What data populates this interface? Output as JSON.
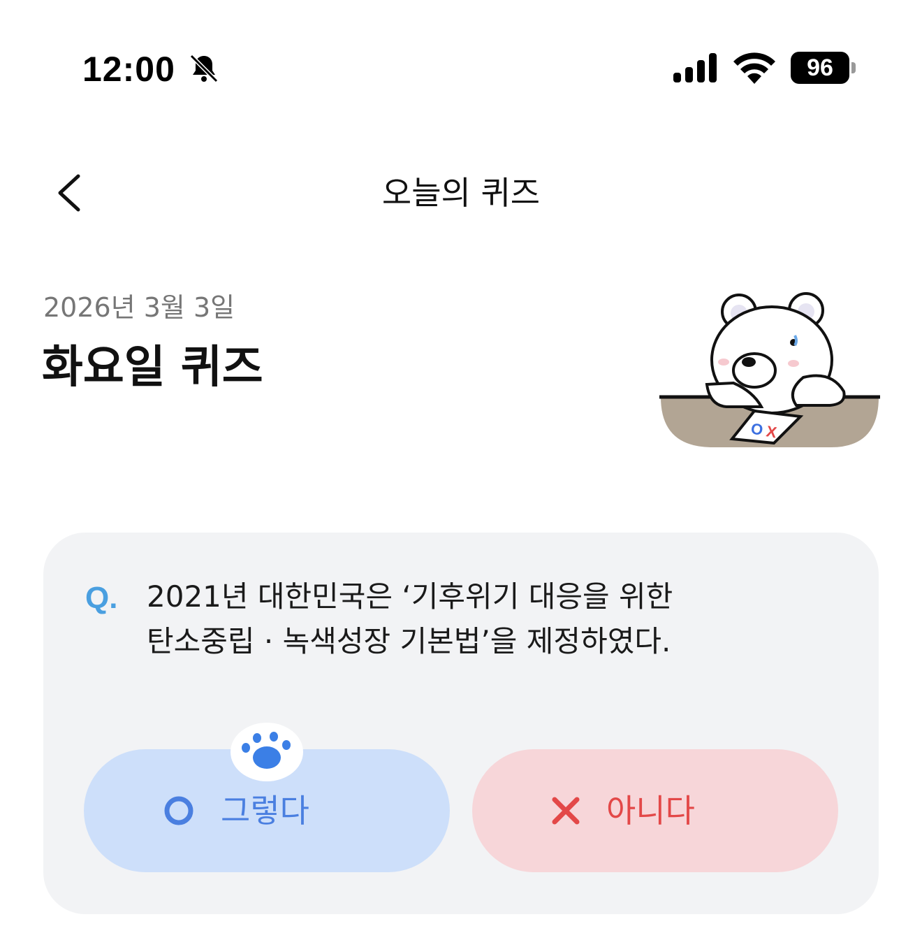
{
  "status_bar": {
    "time": "12:00",
    "bell_icon": "bell-slash-icon",
    "signal_icon": "cellular-signal-icon",
    "wifi_icon": "wifi-icon",
    "battery_level": "96"
  },
  "header": {
    "back_icon": "chevron-left-icon",
    "title": "오늘의 퀴즈"
  },
  "quiz": {
    "date": "2026년 3월 3일",
    "title": "화요일 퀴즈",
    "illustration": "bear-with-ox-paper",
    "question_prefix": "Q.",
    "question_lines": [
      "2021년 대한민국은 ‘기후위기 대응을 위한",
      "탄소중립 · 녹색성장 기본법’을 제정하였다."
    ],
    "answers": {
      "yes": {
        "icon": "circle-o-icon",
        "label": "그렇다"
      },
      "no": {
        "icon": "x-mark-icon",
        "label": "아니다"
      }
    },
    "selected_indicator_icon": "paw-icon"
  },
  "colors": {
    "accent_blue": "#4a7fe0",
    "q_blue": "#4a9fe0",
    "yes_bg": "#cddffa",
    "no_bg": "#f7d6d9",
    "no_red": "#e34848",
    "card_bg": "#f2f3f5"
  }
}
